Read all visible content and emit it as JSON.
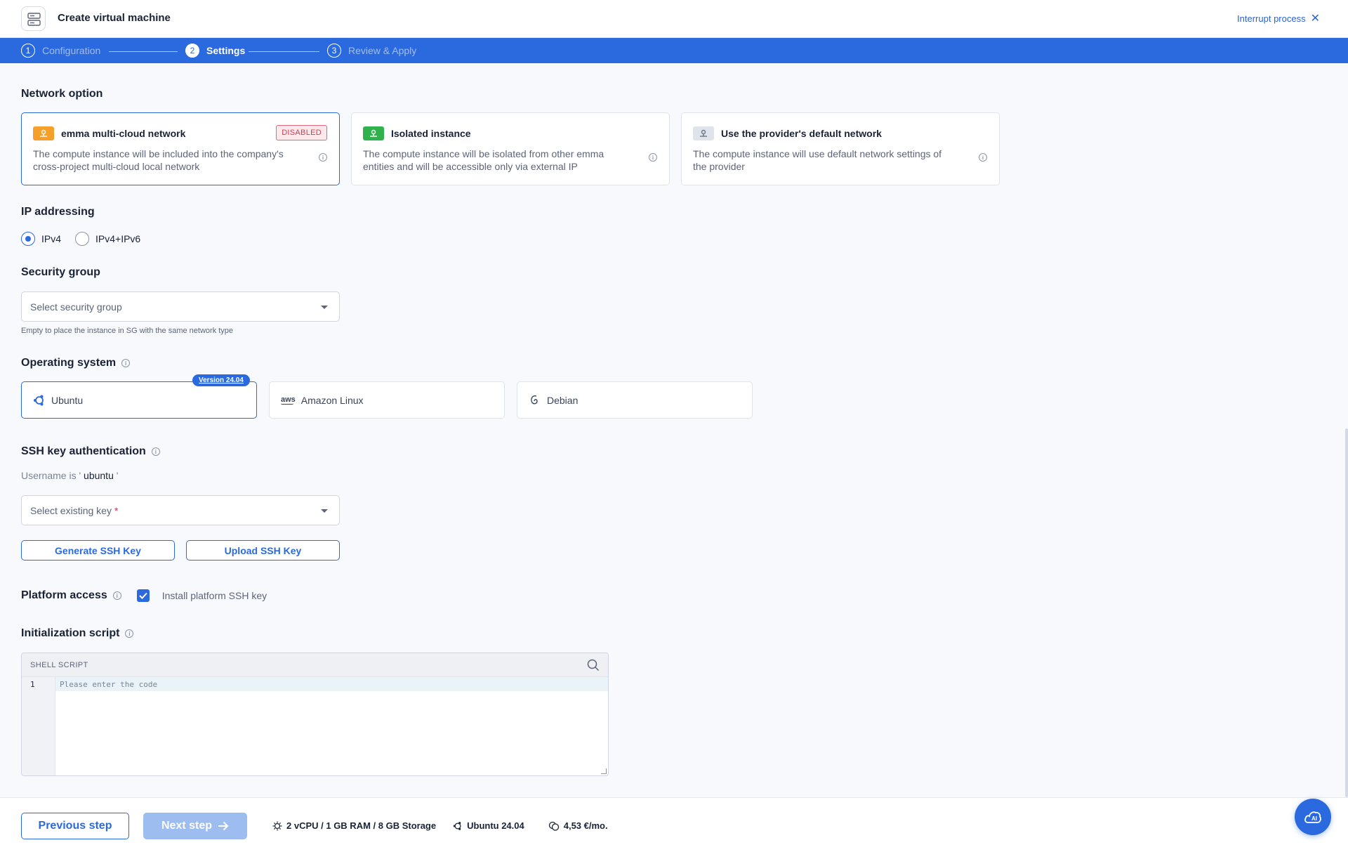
{
  "header": {
    "title": "Create virtual machine",
    "interrupt_label": "Interrupt process"
  },
  "stepper": {
    "steps": [
      {
        "num": "1",
        "label": "Configuration"
      },
      {
        "num": "2",
        "label": "Settings"
      },
      {
        "num": "3",
        "label": "Review & Apply"
      }
    ],
    "active_step": 2
  },
  "network": {
    "title": "Network option",
    "options": [
      {
        "title": "emma multi-cloud network",
        "badge": "DISABLED",
        "desc": "The compute instance will be included into the company's cross-project multi-cloud local network"
      },
      {
        "title": "Isolated instance",
        "desc": "The compute instance will be isolated from other emma entities and will be accessible only via external IP"
      },
      {
        "title": "Use the provider's default network",
        "desc": "The compute instance will use default network settings of the provider"
      }
    ],
    "selected": 0
  },
  "ip": {
    "title": "IP addressing",
    "options": [
      "IPv4",
      "IPv4+IPv6"
    ],
    "selected": "IPv4"
  },
  "security": {
    "title": "Security group",
    "placeholder": "Select security group",
    "helper": "Empty to place the instance in SG with the same network type"
  },
  "os": {
    "title": "Operating system",
    "version_badge": "Version 24.04",
    "options": [
      "Ubuntu",
      "Amazon Linux",
      "Debian"
    ],
    "selected": "Ubuntu"
  },
  "ssh": {
    "title": "SSH key authentication",
    "username_prefix": "Username is ' ",
    "username": "ubuntu",
    "username_suffix": " '",
    "key_placeholder": "Select existing key",
    "required_mark": "*",
    "generate_label": "Generate SSH Key",
    "upload_label": "Upload SSH Key"
  },
  "platform": {
    "title": "Platform access",
    "checkbox_label": "Install platform SSH key",
    "checked": true
  },
  "init": {
    "title": "Initialization script",
    "lang_label": "SHELL SCRIPT",
    "line_number": "1",
    "code_placeholder": "Please enter the code"
  },
  "footer": {
    "prev_label": "Previous step",
    "next_label": "Next step",
    "specs": "2 vCPU / 1 GB RAM / 8 GB Storage",
    "os": "Ubuntu 24.04",
    "price": "4,53 €/mo."
  },
  "colors": {
    "accent": "#2b6ade",
    "disabled_badge": "#d23a52",
    "multicloud_icon": "#f4a02a",
    "isolated_icon": "#2fb24c",
    "default_icon": "#dfe3ea"
  }
}
